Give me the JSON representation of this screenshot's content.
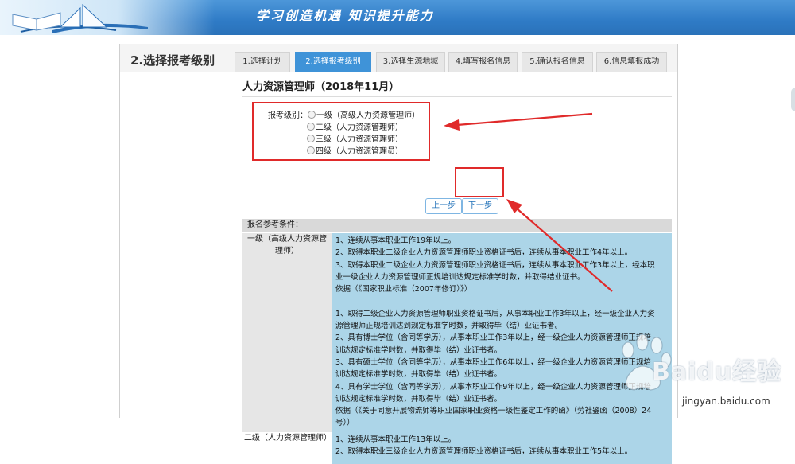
{
  "banner": {
    "slogan": "学习创造机遇  知识提升能力"
  },
  "page_title": "2.选择报考级别",
  "tabs": [
    {
      "label": "1.选择计划",
      "active": false
    },
    {
      "label": "2.选择报考级别",
      "active": true
    },
    {
      "label": "3,选择生源地域",
      "active": false
    },
    {
      "label": "4.填写报名信息",
      "active": false
    },
    {
      "label": "5.确认报名信息",
      "active": false
    },
    {
      "label": "6.信息填报成功",
      "active": false
    }
  ],
  "course_title": "人力资源管理师（2018年11月）",
  "level_form": {
    "label": "报考级别：",
    "options": [
      "一级（高级人力资源管理师）",
      "二级（人力资源管理师）",
      "三级（人力资源管理师）",
      "四级（人力资源管理员）"
    ],
    "selected": null
  },
  "buttons": {
    "prev": "上一步",
    "next": "下一步"
  },
  "requirements": {
    "header": "报名参考条件：",
    "sections": [
      {
        "label": "一级（高级人力资源管理师）",
        "lines": [
          "1、连续从事本职业工作19年以上。",
          "2、取得本职业二级企业人力资源管理师职业资格证书后，连续从事本职业工作4年以上。",
          "3、取得本职业二级企业人力资源管理师职业资格证书后，连续从事本职业工作3年以上，经本职",
          "业一级企业人力资源管理师正规培训达规定标准学时数，并取得结业证书。",
          "依据（《国家职业标准（2007年修订）》）",
          "",
          "1、取得二级企业人力资源管理师职业资格证书后，从事本职业工作3年以上，经一级企业人力资",
          "源管理师正规培训达到规定标准学时数，并取得毕（结）业证书者。",
          "2、具有博士学位（含同等学历），从事本职业工作3年以上，经一级企业人力资源管理师正规培",
          "训达规定标准学时数，并取得毕（结）业证书者。",
          "3、具有硕士学位（含同等学历），从事本职业工作6年以上，经一级企业人力资源管理师正规培",
          "训达规定标准学时数，并取得毕（结）业证书者。",
          "4、具有学士学位（含同等学历），从事本职业工作9年以上，经一级企业人力资源管理师正规培",
          "训达规定标准学时数，并取得毕（结）业证书者。",
          "依据（《关于同意开展物流师等职业国家职业资格一级性鉴定工作的函》（劳社鉴函（2008）24",
          "号））"
        ]
      },
      {
        "label": "二级（人力资源管理师）",
        "lines": [
          "1、连续从事本职业工作13年以上。",
          "2、取得本职业三级企业人力资源管理师职业资格证书后，连续从事本职业工作5年以上。"
        ]
      }
    ]
  },
  "watermark": {
    "text": "Baidu经验",
    "url": "jingyan.baidu.com"
  },
  "colors": {
    "accent": "#3f93d8",
    "annotation_red": "#e02a2a",
    "requirement_bg": "#acd5e8"
  }
}
